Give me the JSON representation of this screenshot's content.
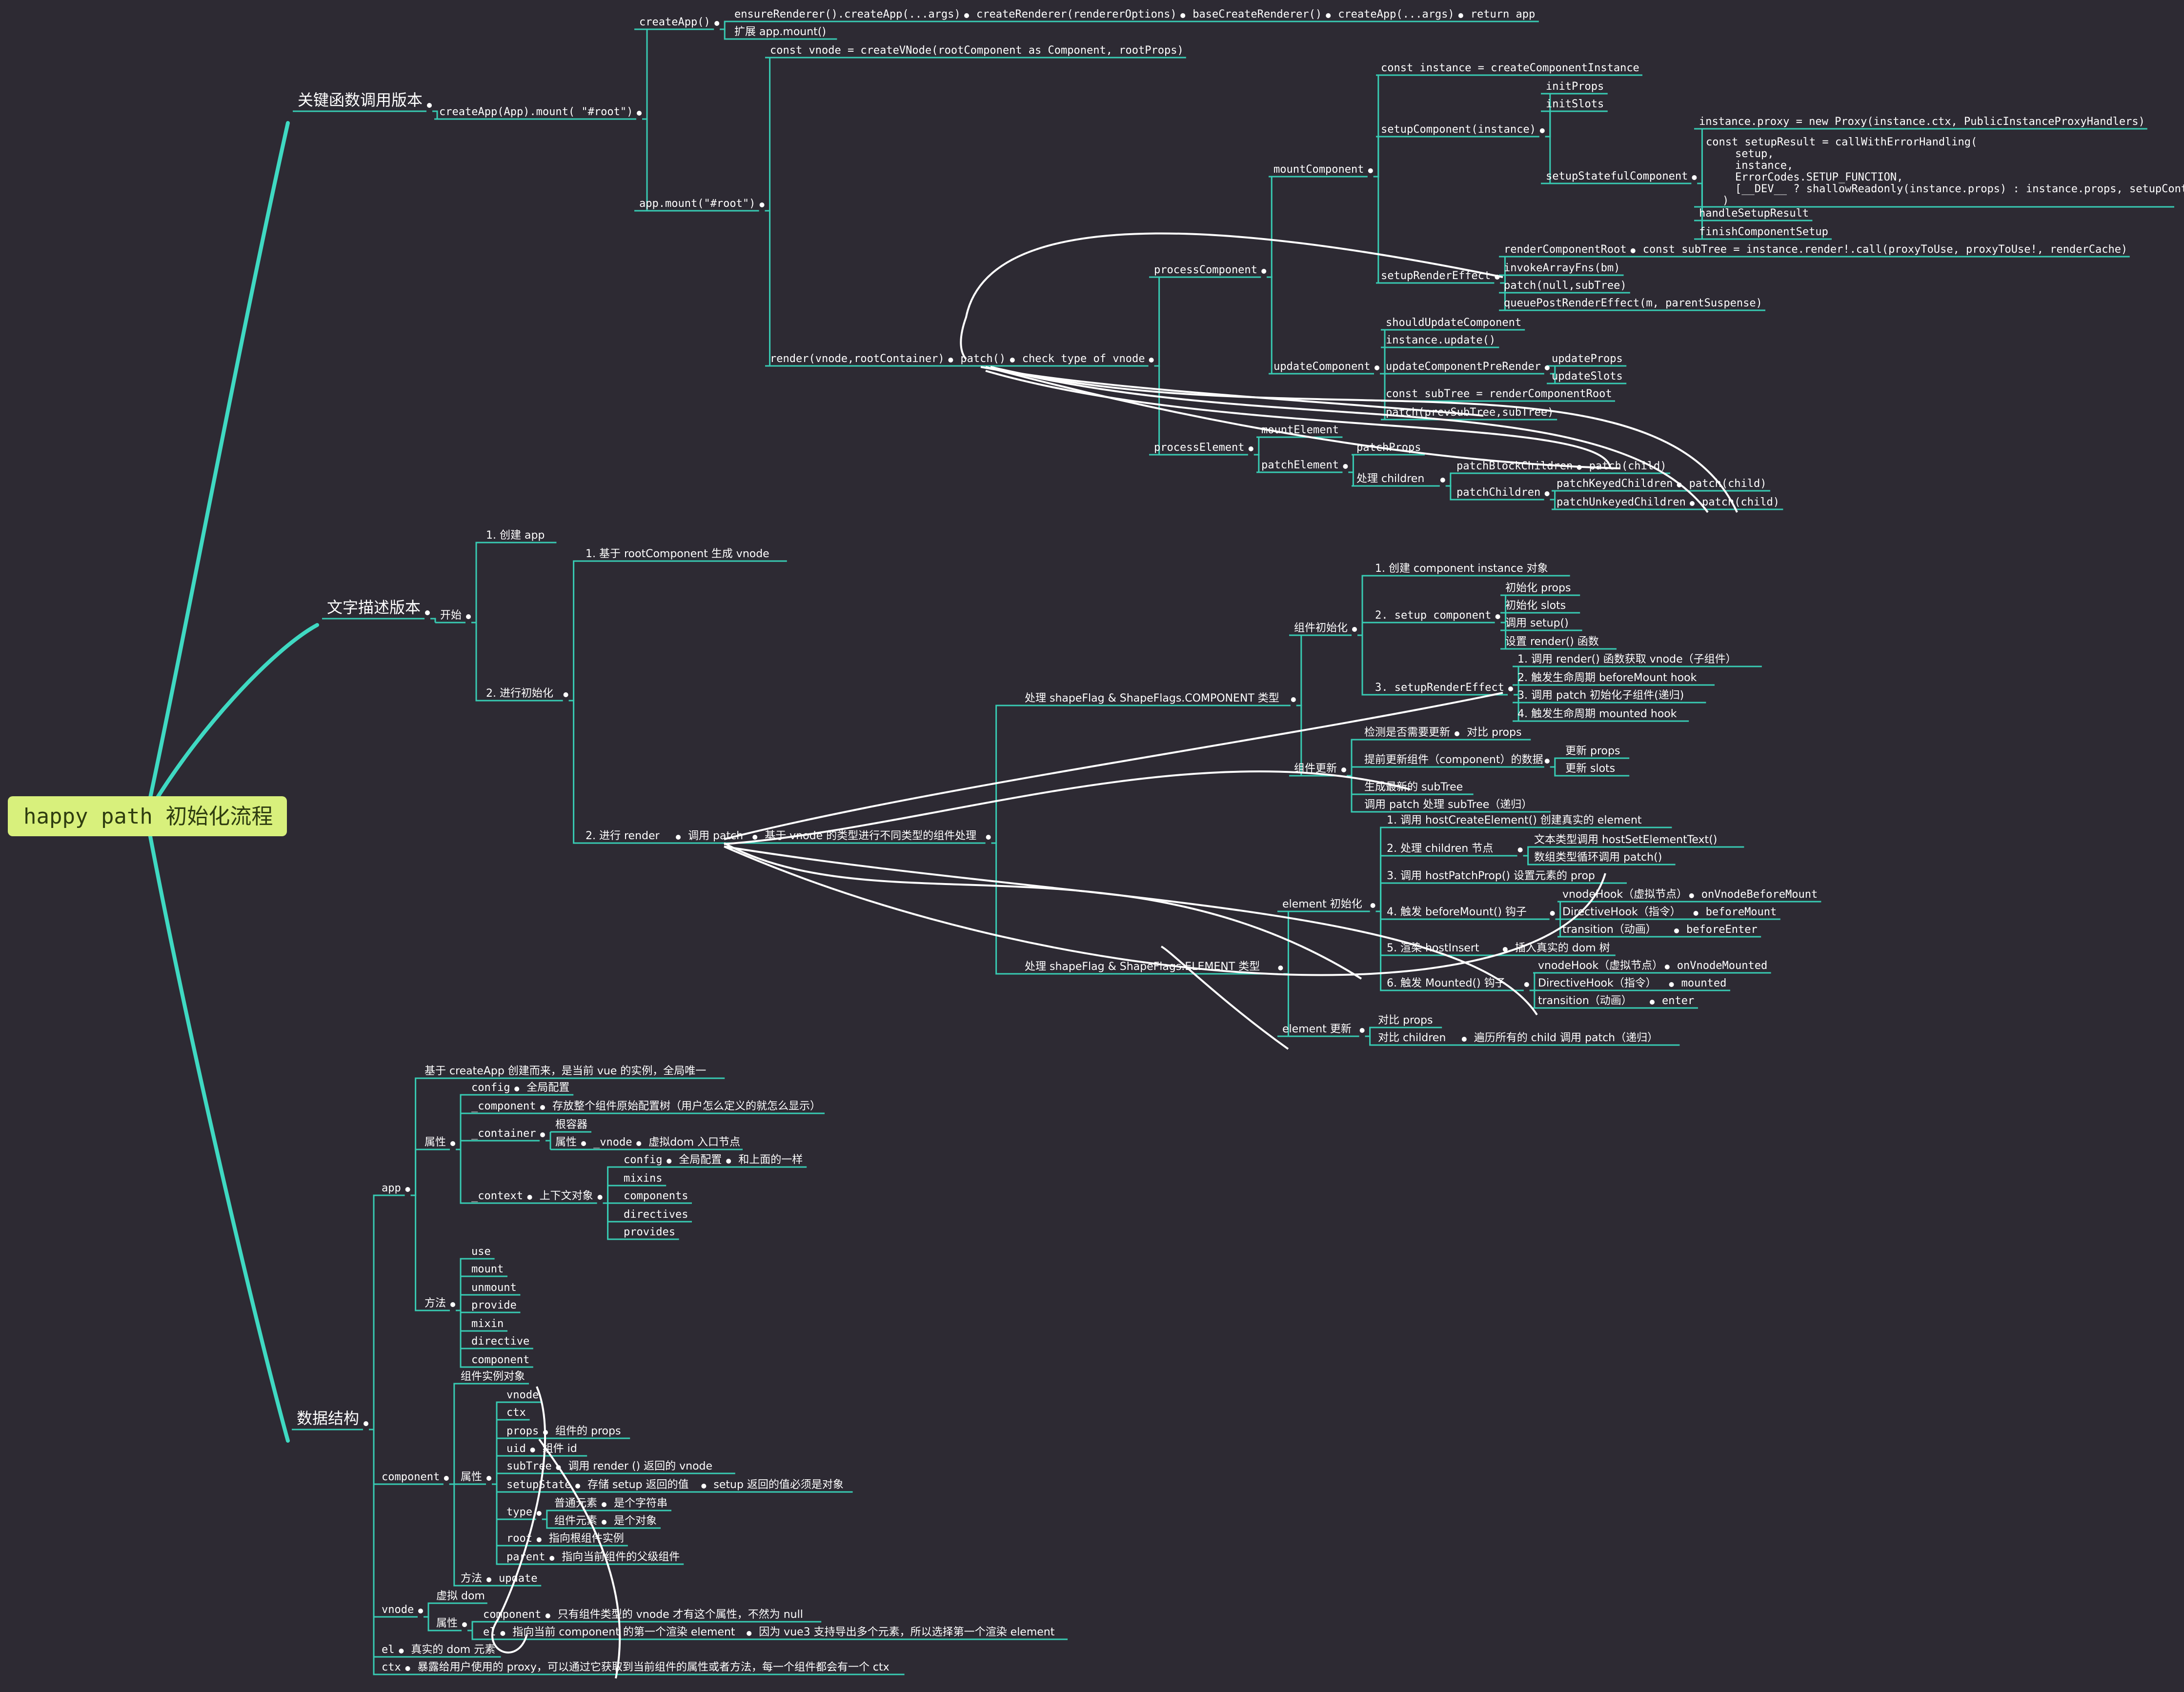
{
  "colors": {
    "background": "#2d2a33",
    "branch": "#38cbb3",
    "root_fill": "#d8f07c",
    "text": "#ffffff",
    "arrow": "#ffffff"
  },
  "root": {
    "label": "happy path 初始化流程"
  },
  "n": {
    "k": "关键函数调用版本",
    "k1": "createApp(App).mount( \"#root\")",
    "k1a": "createApp()",
    "k1a1": "ensureRenderer().createApp(...args)",
    "k1a1b": "createRenderer(rendererOptions)",
    "k1a1c": "baseCreateRenderer()",
    "k1a1d": "createApp(...args)",
    "k1a1e": "return app",
    "k1a2": "扩展 app.mount()",
    "k1b": "app.mount(\"#root\")",
    "k1b1": "const vnode = createVNode(rootComponent as Component, rootProps)",
    "k1b2": "render(vnode,rootContainer)",
    "k1b2a": "patch()",
    "k1b2b": "check type of vnode",
    "pc": "processComponent",
    "mc": "mountComponent",
    "mc1": "const instance = createComponentInstance",
    "mc2": "setupComponent(instance)",
    "mc2a": "initProps",
    "mc2b": "initSlots",
    "mc2c": "setupStatefulComponent",
    "mc2c1": "instance.proxy = new Proxy(instance.ctx, PublicInstanceProxyHandlers)",
    "mc2c2a": "const setupResult = callWithErrorHandling(",
    "mc2c2b": "setup,",
    "mc2c2c": "instance,",
    "mc2c2d": "ErrorCodes.SETUP_FUNCTION,",
    "mc2c2e": "[__DEV__ ? shallowReadonly(instance.props) : instance.props, setupContext]",
    "mc2c2f": ")",
    "mc2c3": "handleSetupResult",
    "mc2c4": "finishComponentSetup",
    "mc3": "setupRenderEffect",
    "mc3a": "renderComponentRoot",
    "mc3a1": "const subTree = instance.render!.call(proxyToUse, proxyToUse!, renderCache)",
    "mc3b": "invokeArrayFns(bm)",
    "mc3c": "patch(null,subTree)",
    "mc3d": "queuePostRenderEffect(m, parentSuspense)",
    "uc": "updateComponent",
    "uc1": "shouldUpdateComponent",
    "uc2": "instance.update()",
    "uc3": "updateComponentPreRender",
    "uc3a": "updateProps",
    "uc3b": "updateSlots",
    "uc4": "const subTree = renderComponentRoot",
    "uc5": "patch(prevSubTree,subTree)",
    "pe": "processElement",
    "pe1": "mountElement",
    "pe2": "patchElement",
    "pe2a": "patchProps",
    "pe2b": "处理 children",
    "pe2b1": "patchBlockChildren",
    "pe2b1a": "patch(child)",
    "pe2b2": "patchChildren",
    "pe2b2a": "patchKeyedChildren",
    "pe2b2b": "patch(child)",
    "pe2b2c": "patchUnkeyedChildren",
    "pe2b2d": "patch(child)",
    "t": "文字描述版本",
    "t1": "开始",
    "t1a": "1. 创建 app",
    "t1b": "2. 进行初始化",
    "t1b1": "1. 基于 rootComponent 生成 vnode",
    "t1b2": "2. 进行 render",
    "t1b2a": "调用 patch",
    "t1b2b": "基于 vnode 的类型进行不同类型的组件处理",
    "tc": "处理 shapeFlag & ShapeFlags.COMPONENT 类型",
    "tci": "组件初始化",
    "tci1": "1. 创建 component instance 对象",
    "tci2": "2. setup component",
    "tci2a": "初始化 props",
    "tci2b": "初始化 slots",
    "tci2c": "调用 setup()",
    "tci2d": "设置 render() 函数",
    "tci3": "3. setupRenderEffect",
    "tci3a": "1. 调用 render() 函数获取 vnode（子组件）",
    "tci3b": "2. 触发生命周期 beforeMount hook",
    "tci3c": "3. 调用 patch 初始化子组件(递归)",
    "tci3d": "4. 触发生命周期 mounted hook",
    "tcu": "组件更新",
    "tcu1": "检测是否需要更新",
    "tcu1a": "对比 props",
    "tcu2": "提前更新组件（component）的数据",
    "tcu2a": "更新 props",
    "tcu2b": "更新 slots",
    "tcu3": "生成最新的 subTree",
    "tcu4": "调用 patch 处理 subTree（递归）",
    "te": "处理 shapeFlag & ShapeFlags.ELEMENT 类型",
    "tei": "element 初始化",
    "tei1": "1. 调用 hostCreateElement() 创建真实的 element",
    "tei2": "2. 处理 children 节点",
    "tei2a": "文本类型调用  hostSetElementText()",
    "tei2b": "数组类型循环调用 patch()",
    "tei3": "3. 调用 hostPatchProp() 设置元素的 prop",
    "tei4": "4. 触发 beforeMount() 钩子",
    "tei4a": "vnodeHook（虚拟节点）",
    "tei4a1": "onVnodeBeforeMount",
    "tei4b": "DirectiveHook（指令）",
    "tei4b1": "beforeMount",
    "tei4c": "transition（动画）",
    "tei4c1": "beforeEnter",
    "tei5": "5. 渲染 hostInsert",
    "tei5a": "插入真实的 dom 树",
    "tei6": "6. 触发 Mounted() 钩子",
    "tei6a": "vnodeHook（虚拟节点）",
    "tei6a1": "onVnodeMounted",
    "tei6b": "DirectiveHook（指令）",
    "tei6b1": "mounted",
    "tei6c": "transition（动画）",
    "tei6c1": "enter",
    "teu": "element 更新",
    "teu1": "对比 props",
    "teu2": "对比 children",
    "teu2a": "遍历所有的 child 调用 patch（递归）",
    "d": "数据结构",
    "da": "app",
    "da1": "基于 createApp 创建而来，是当前 vue 的实例，全局唯一",
    "da2": "属性",
    "da2a": "config",
    "da2a1": "全局配置",
    "da2b": "_component",
    "da2b1": "存放整个组件原始配置树（用户怎么定义的就怎么显示）",
    "da2c": "_container",
    "da2c1": "根容器",
    "da2c2": "属性",
    "da2c2a": "_vnode",
    "da2c2b": "虚拟dom 入口节点",
    "da2d": "_context",
    "da2d0": "上下文对象",
    "da2d1": "config",
    "da2d1a": "全局配置",
    "da2d1b": "和上面的一样",
    "da2d2": "mixins",
    "da2d3": "components",
    "da2d4": "directives",
    "da2d5": "provides",
    "da3": "方法",
    "da3a": "use",
    "da3b": "mount",
    "da3c": "unmount",
    "da3d": "provide",
    "da3e": "mixin",
    "da3f": "directive",
    "da3g": "component",
    "dc": "component",
    "dc1": "组件实例对象",
    "dc2": "属性",
    "dc2a": "vnode",
    "dc2b": "ctx",
    "dc2c": "props",
    "dc2c1": "组件的 props",
    "dc2d": "uid",
    "dc2d1": "组件 id",
    "dc2e": "subTree",
    "dc2e1": "调用 render () 返回的 vnode",
    "dc2f": "setupState",
    "dc2f1": "存储 setup 返回的值",
    "dc2f2": "setup 返回的值必须是对象",
    "dc2g": "type",
    "dc2g1": "普通元素",
    "dc2g1a": "是个字符串",
    "dc2g2": "组件元素",
    "dc2g2a": "是个对象",
    "dc2h": "root",
    "dc2h1": "指向根组件实例",
    "dc2i": "parent",
    "dc2i1": "指向当前组件的父级组件",
    "dc3": "方法",
    "dc3a": "update",
    "dv": "vnode",
    "dv1": "虚拟 dom",
    "dv2": "属性",
    "dv2a": "component",
    "dv2a1": "只有组件类型的 vnode 才有这个属性，不然为 null",
    "dv2b": "el",
    "dv2b1": "指向当前 component 的第一个渲染 element",
    "dv2b2": "因为 vue3 支持导出多个元素，所以选择第一个渲染 element",
    "de": "el",
    "de1": "真实的 dom 元素",
    "dx": "ctx",
    "dx1": "暴露给用户使用的 proxy，可以通过它获取到当前组件的属性或者方法，每一个组件都会有一个 ctx"
  }
}
